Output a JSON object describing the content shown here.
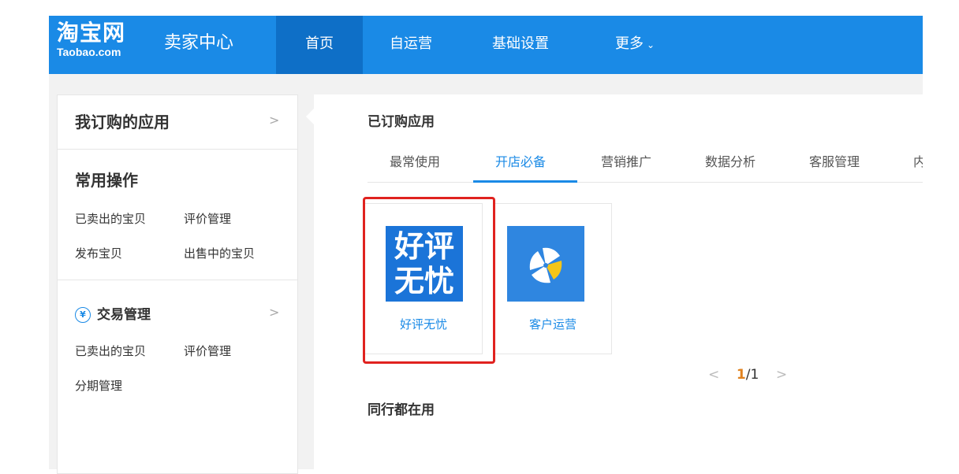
{
  "header": {
    "logo_cn": "淘宝网",
    "logo_en": "Taobao.com",
    "seller_center": "卖家中心",
    "nav": [
      "首页",
      "自运营",
      "基础设置",
      "更多"
    ]
  },
  "sidebar": {
    "subscribed_title": "我订购的应用",
    "common_title": "常用操作",
    "common_links": [
      "已卖出的宝贝",
      "评价管理",
      "发布宝贝",
      "出售中的宝贝"
    ],
    "trade_title": "交易管理",
    "trade_links": [
      "已卖出的宝贝",
      "评价管理",
      "分期管理"
    ]
  },
  "main": {
    "subscribed_apps_title": "已订购应用",
    "tabs": [
      "最常使用",
      "开店必备",
      "营销推广",
      "数据分析",
      "客服管理",
      "内"
    ],
    "active_tab": "开店必备",
    "apps": [
      {
        "name": "好评无忧",
        "icon_text_line1": "好评",
        "icon_text_line2": "无忧"
      },
      {
        "name": "客户运营",
        "icon": "pinwheel-icon"
      }
    ],
    "pager": {
      "current": "1",
      "total": "/1"
    },
    "peers_title": "同行都在用"
  },
  "colors": {
    "brand_blue": "#1a8ae6",
    "highlight_red": "#e0221f",
    "pager_orange": "#e0821f"
  }
}
